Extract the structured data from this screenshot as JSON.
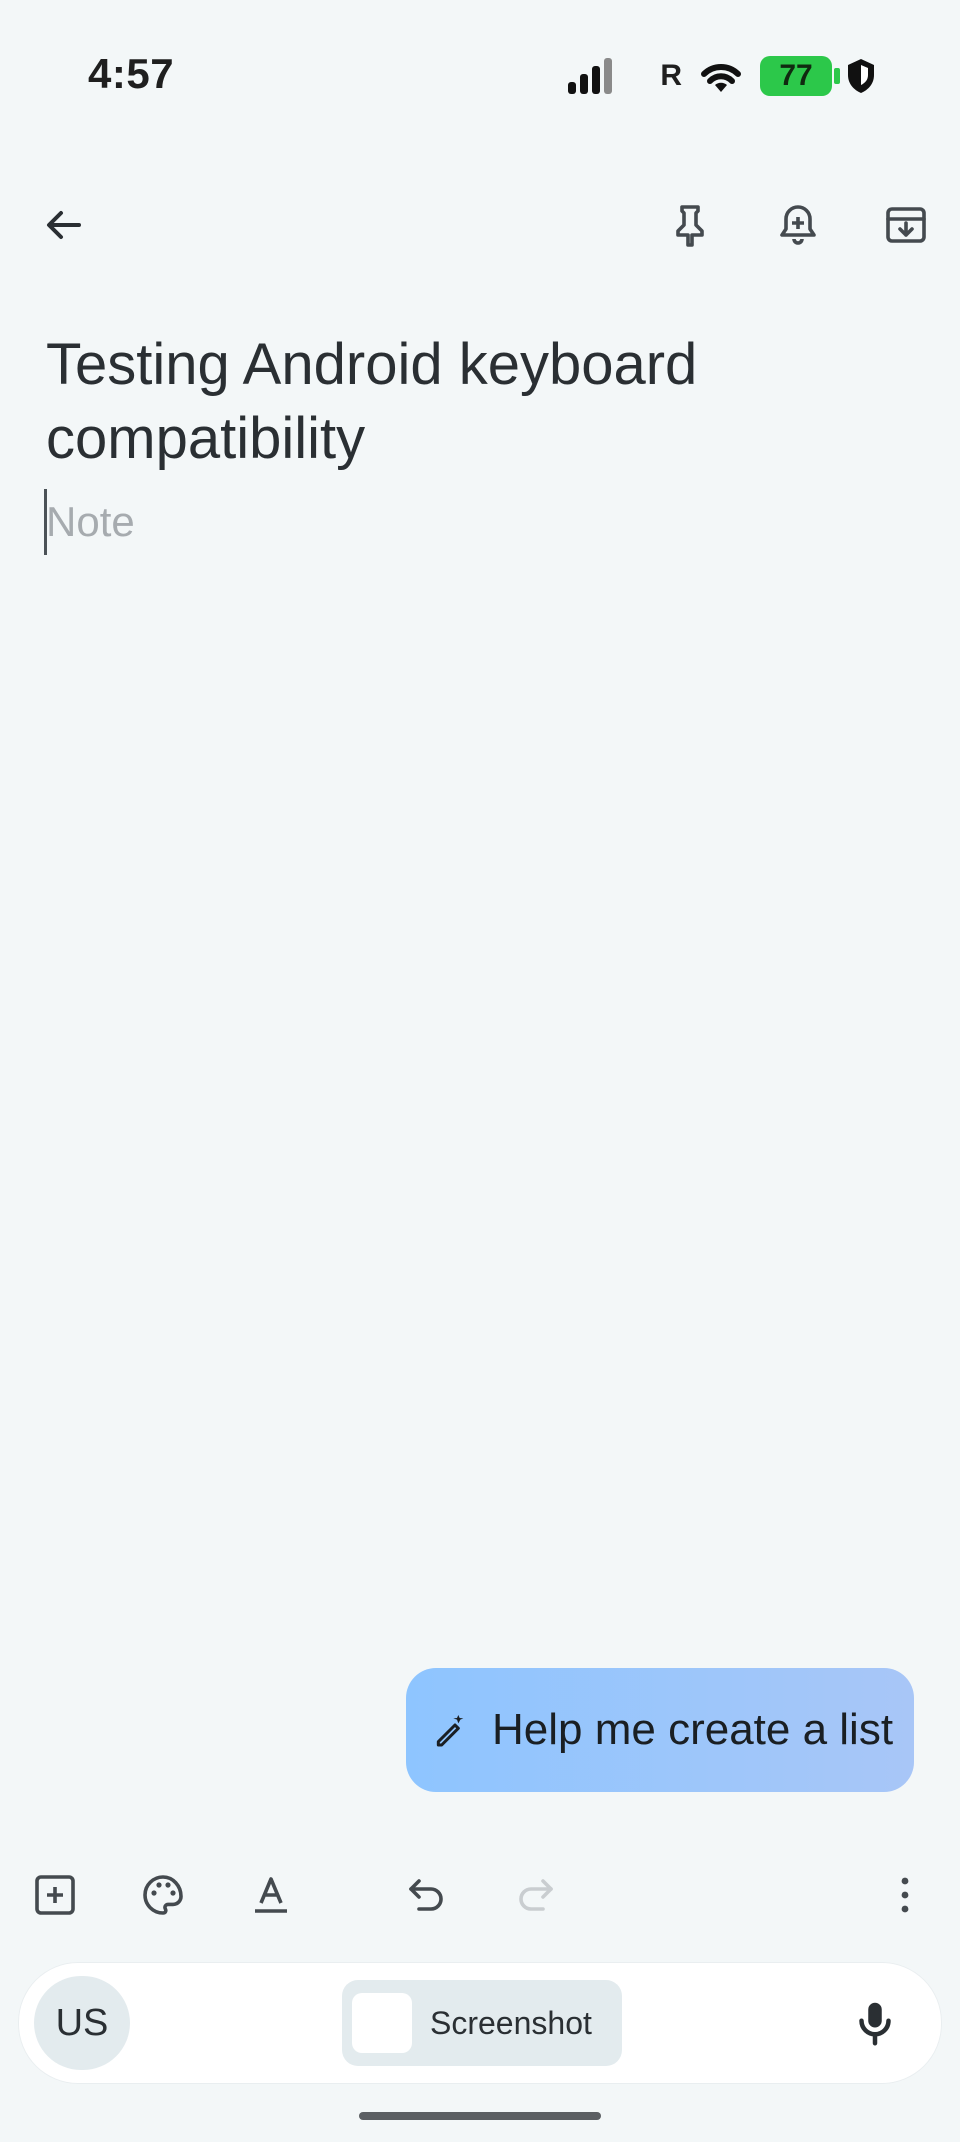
{
  "status_bar": {
    "time": "4:57",
    "battery_level": "77",
    "roaming_indicator": "R"
  },
  "top_toolbar": {
    "icons": [
      "back-arrow-icon",
      "pin-icon",
      "add-reminder-icon",
      "archive-icon"
    ]
  },
  "note": {
    "title": "Testing Android keyboard compatibility",
    "body_placeholder": "Note"
  },
  "assist": {
    "help_label": "Help me create a list"
  },
  "editor_toolbar": {
    "icons": [
      "add-box-icon",
      "palette-icon",
      "text-format-icon",
      "undo-icon",
      "redo-icon",
      "more-vert-icon"
    ]
  },
  "keyboard_bar": {
    "language": "US",
    "suggestion": "Screenshot"
  },
  "colors": {
    "background": "#f3f7f8",
    "help_gradient_start": "#8ec5ff",
    "help_gradient_end": "#a8c6f7",
    "battery": "#2cc84a"
  }
}
